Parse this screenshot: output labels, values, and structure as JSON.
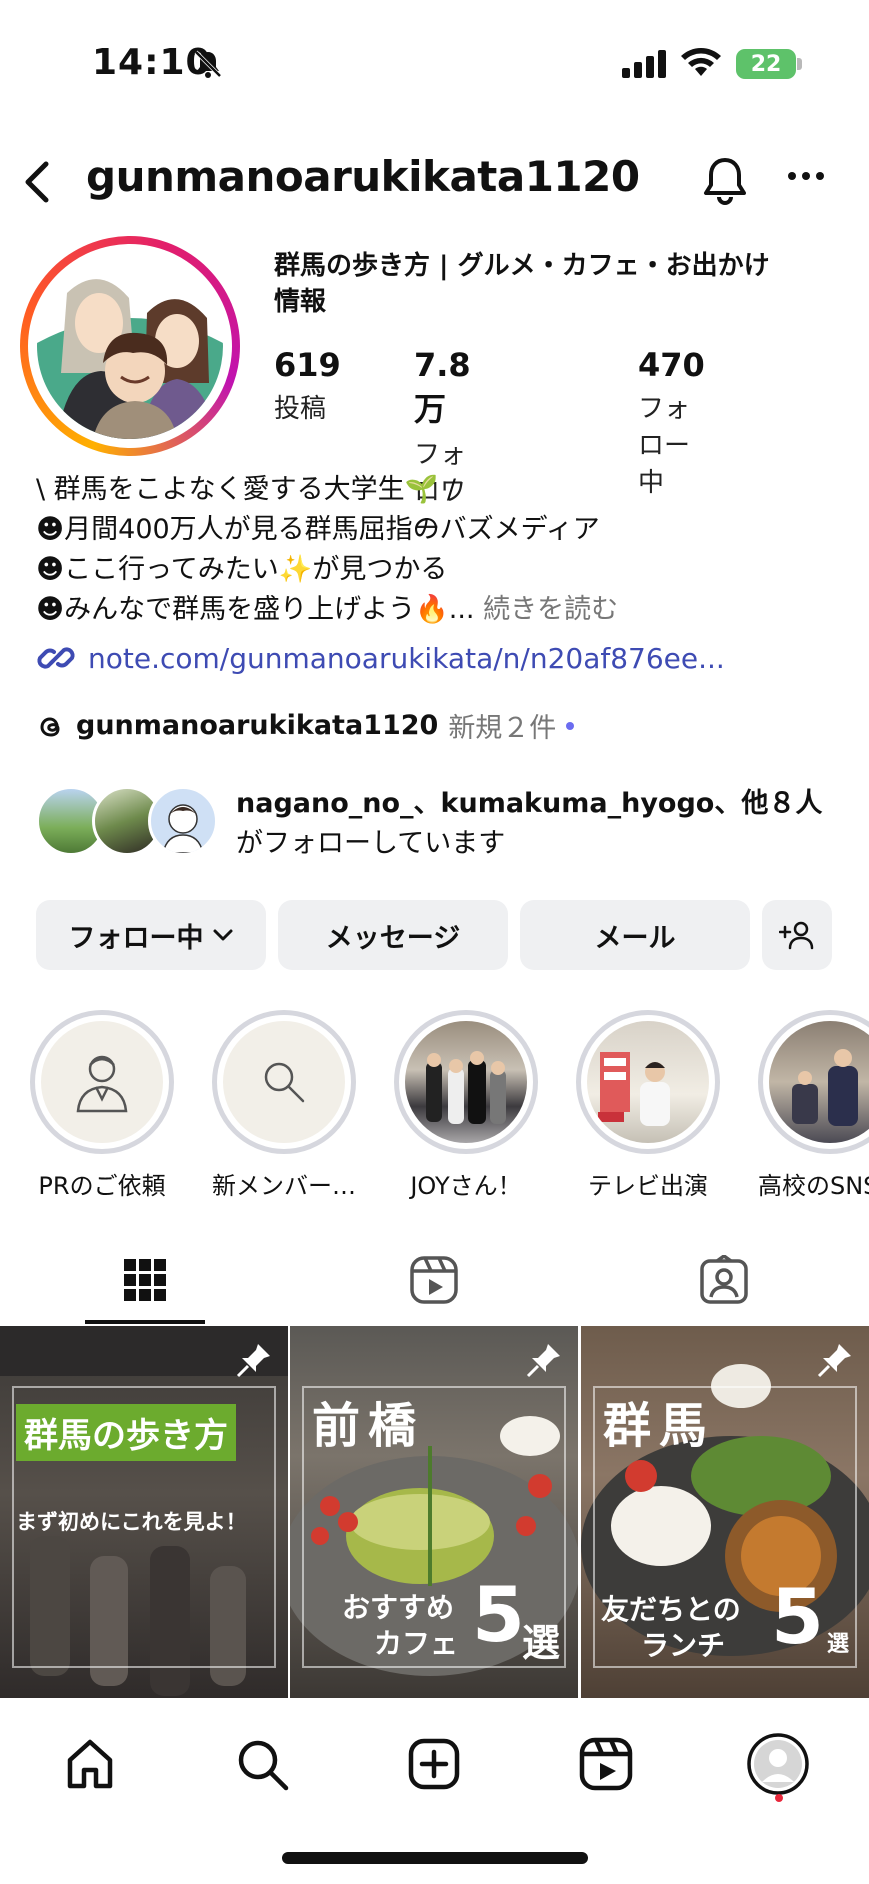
{
  "status_bar": {
    "time": "14:10",
    "battery": "22"
  },
  "header": {
    "username": "gunmanoarukikata1120"
  },
  "profile": {
    "name_line1": "群馬の歩き方 | グルメ・カフェ・お出かけ",
    "name_line2": "情報",
    "stats": [
      {
        "value": "619",
        "label": "投稿"
      },
      {
        "value": "7.8万",
        "label": "フォロワー"
      },
      {
        "value": "470",
        "label": "フォロー中"
      }
    ],
    "bio": [
      "\\ 群馬をこよなく愛する大学生🌱 /",
      "☻月間400万人が見る群馬屈指のバズメディア",
      "☻ここ行ってみたい✨が見つかる",
      "☻みんなで群馬を盛り上げよう🔥..."
    ],
    "bio_more": "続きを読む",
    "link": "note.com/gunmanoarukikata/n/n20af876ee...",
    "threads_name": "gunmanoarukikata1120",
    "threads_new": "新規２件",
    "followed_by_names": "nagano_no_、kumakuma_hyogo、他８人",
    "followed_by_suffix": "がフォローしています"
  },
  "actions": {
    "following": "フォロー中",
    "message": "メッセージ",
    "mail": "メール"
  },
  "highlights": [
    {
      "label": "PRのご依頼",
      "icon": "person-suit-icon"
    },
    {
      "label": "新メンバー…",
      "icon": "search-icon"
    },
    {
      "label": "JOYさん！",
      "icon": "photo"
    },
    {
      "label": "テレビ出演",
      "icon": "photo"
    },
    {
      "label": "高校のSNS",
      "icon": "photo"
    }
  ],
  "posts": [
    {
      "title": "群馬の歩き方",
      "subtitle": "まず初めにこれを見よ！",
      "pinned": true
    },
    {
      "title": "前橋",
      "line1": "おすすめ",
      "line2": "カフェ",
      "number": "5",
      "suffix": "選",
      "pinned": true
    },
    {
      "title": "群馬",
      "line1": "友だちとの",
      "line2": "ランチ",
      "number": "5",
      "suffix": "選",
      "pinned": true
    }
  ],
  "colors": {
    "link": "#3e4bb3",
    "button_bg": "#eff0f2",
    "accent_green": "#6cab2e"
  }
}
